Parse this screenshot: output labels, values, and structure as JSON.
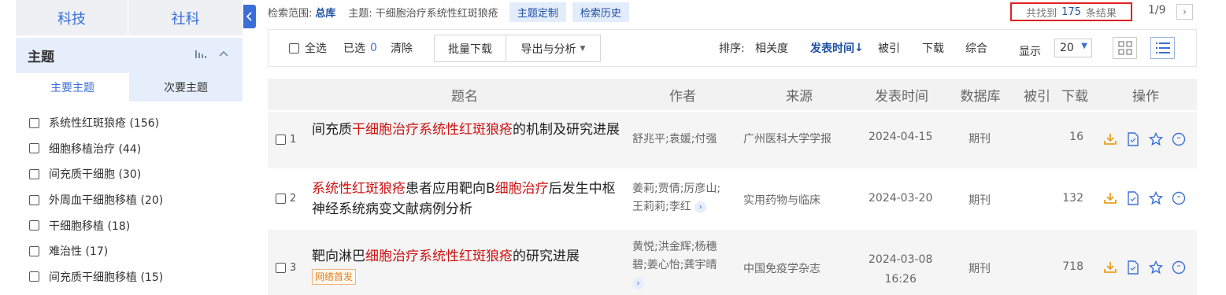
{
  "categories": {
    "tab1": "科技",
    "tab2": "社科"
  },
  "facet": {
    "title": "主题",
    "chart_icon": "bar-chart-icon",
    "collapse_icon": "chevron-up-icon",
    "subtabs": {
      "primary": "主要主题",
      "secondary": "次要主题"
    },
    "items": [
      {
        "label": "系统性红斑狼疮 (156)"
      },
      {
        "label": "细胞移植治疗 (44)"
      },
      {
        "label": "间充质干细胞 (30)"
      },
      {
        "label": "外周血干细胞移植 (20)"
      },
      {
        "label": "干细胞移植 (18)"
      },
      {
        "label": "难治性 (17)"
      },
      {
        "label": "间充质干细胞移植 (15)"
      }
    ]
  },
  "search": {
    "scope_label": "检索范围:",
    "scope_value": "总库",
    "topic_label": "主题:",
    "topic_value": "干细胞治疗系统性红斑狼疮",
    "customize": "主题定制",
    "history": "检索历史",
    "result_prefix": "共找到",
    "result_count": "175",
    "result_suffix": "条结果",
    "page": "1/9",
    "next": "›"
  },
  "toolbar": {
    "select_all": "全选",
    "selected_label": "已选",
    "selected_count": "0",
    "clear": "清除",
    "batch_download": "批量下载",
    "export": "导出与分析",
    "sort_label": "排序:",
    "sort_relevance": "相关度",
    "sort_date": "发表时间",
    "sort_date_arrow": "↓",
    "sort_cited": "被引",
    "sort_download": "下载",
    "sort_overall": "综合",
    "display_label": "显示",
    "display_value": "20"
  },
  "table": {
    "headers": {
      "title": "题名",
      "author": "作者",
      "source": "来源",
      "date": "发表时间",
      "database": "数据库",
      "cited": "被引",
      "downloads": "下载",
      "ops": "操作"
    },
    "rows": [
      {
        "num": "1",
        "title_parts": [
          "间充质",
          "干细胞治疗系统性红斑狼疮",
          "的机制及研究进展"
        ],
        "authors": "舒兆平;袁媛;付强",
        "source": "广州医科大学学报",
        "date": "2024-04-15",
        "database": "期刊",
        "cited": "",
        "downloads": "16"
      },
      {
        "num": "2",
        "title_parts": [
          "系统性红斑狼疮",
          "患者应用靶向B",
          "细胞治疗",
          "后发生中枢神经系统病变文献病例分析"
        ],
        "authors_line1": "姜莉;贾倩;厉彦山;",
        "authors_line2": "王莉莉;李红",
        "source": "实用药物与临床",
        "date": "2024-03-20",
        "database": "期刊",
        "cited": "",
        "downloads": "132"
      },
      {
        "num": "3",
        "title_parts": [
          "靶向淋巴",
          "细胞治疗系统性红斑狼疮",
          "的研究进展"
        ],
        "badge": "网络首发",
        "authors_line1": "黄悦;洪金辉;杨穗",
        "authors_line2": "碧;姜心怡;龚宇晴",
        "source": "中国免疫学杂志",
        "date": "2024-03-08",
        "time": "16:26",
        "database": "期刊",
        "cited": "",
        "downloads": "718"
      }
    ]
  },
  "op_icons": [
    "download-icon",
    "html-read-icon",
    "favorite-star-icon",
    "quote-icon"
  ],
  "colors": {
    "accent": "#3a6fd8",
    "highlight": "#cc1111",
    "result_border": "#e02020",
    "link": "#1e50a2"
  }
}
